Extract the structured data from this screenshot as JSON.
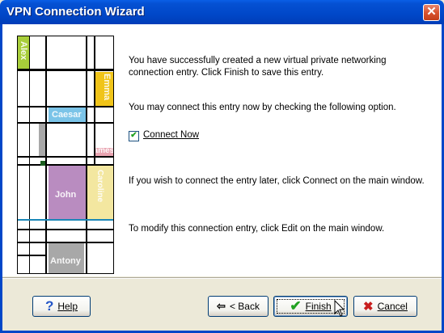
{
  "window": {
    "title": "VPN Connection Wizard",
    "close_glyph": "✕"
  },
  "illustration": {
    "names": [
      "Alex",
      "Emma",
      "Caesar",
      "James",
      "John",
      "Caroline",
      "Antony"
    ]
  },
  "body": {
    "success_text": "You have successfully created a new virtual private networking connection entry. Click Finish to save this entry.",
    "connect_option_text": "You may connect this entry now by checking the following option.",
    "connect_now_label": "Connect Now",
    "connect_now_checked": true,
    "connect_later_text": "If you wish to connect the entry later, click Connect on the main window.",
    "modify_text": "To modify this connection entry, click Edit on the main window."
  },
  "buttons": {
    "help_label": "Help",
    "back_label": "< Back",
    "finish_label": "Finish",
    "cancel_label": "Cancel"
  },
  "icons": {
    "help": "help-icon",
    "back": "back-arrow-icon",
    "finish": "checkmark-icon",
    "cancel": "x-icon",
    "pointer": "mouse-pointer-icon"
  },
  "colors": {
    "title_bar": "#0047C8",
    "dialog_bg": "#ECE9D8",
    "finish_check": "#21A121",
    "cancel_x": "#C81E1E",
    "art_green": "#A8CE3A",
    "art_yellow": "#F0C419",
    "art_blue": "#7BC4E8",
    "art_purple": "#B98CC0",
    "art_lightyellow": "#F3E7A0",
    "art_gray": "#A8A8A8"
  }
}
